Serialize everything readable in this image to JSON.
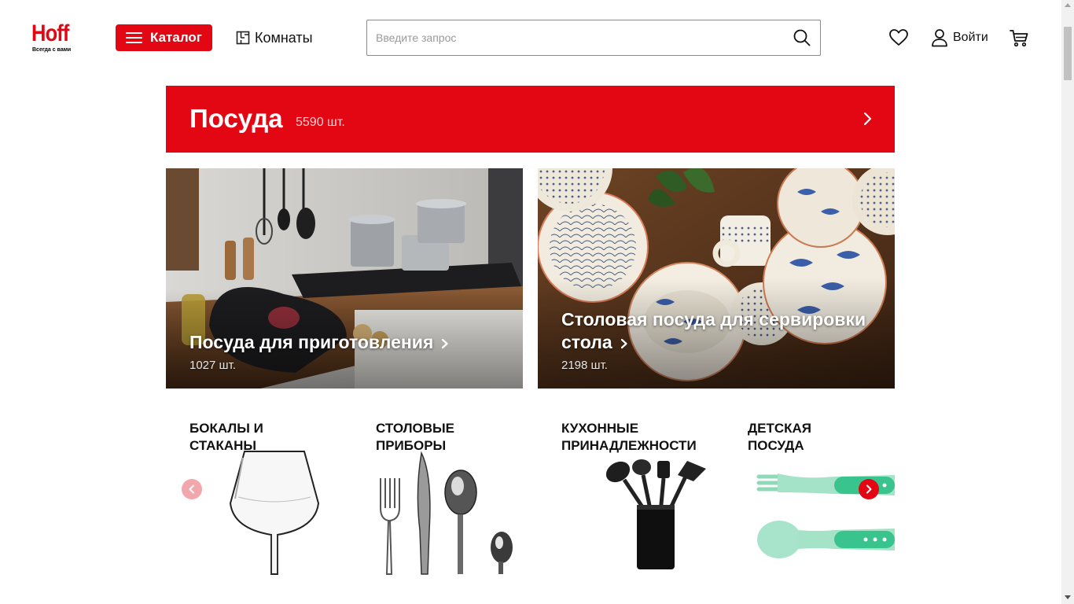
{
  "brand": {
    "logo_text": "Hoff",
    "tagline": "Всегда с вами",
    "accent_color": "#e30613"
  },
  "header": {
    "catalog_label": "Каталог",
    "rooms_label": "Комнаты",
    "search_placeholder": "Введите запрос",
    "login_label": "Войти",
    "icons": [
      "menu-icon",
      "rooms-icon",
      "search-icon",
      "heart-icon",
      "user-icon",
      "cart-icon"
    ]
  },
  "banner": {
    "title": "Посуда",
    "count": "5590 шт."
  },
  "promo_cards": [
    {
      "title": "Посуда для приготовления",
      "count": "1027 шт."
    },
    {
      "title_line1": "Столовая посуда для сервировки",
      "title_line2": "стола",
      "count": "2198 шт."
    }
  ],
  "categories": [
    {
      "line1": "Бокалы и",
      "line2": "стаканы"
    },
    {
      "line1": "Столовые",
      "line2": "приборы"
    },
    {
      "line1": "Кухонные",
      "line2": "принадлежности"
    },
    {
      "line1": "Детская",
      "line2": "посуда"
    }
  ]
}
